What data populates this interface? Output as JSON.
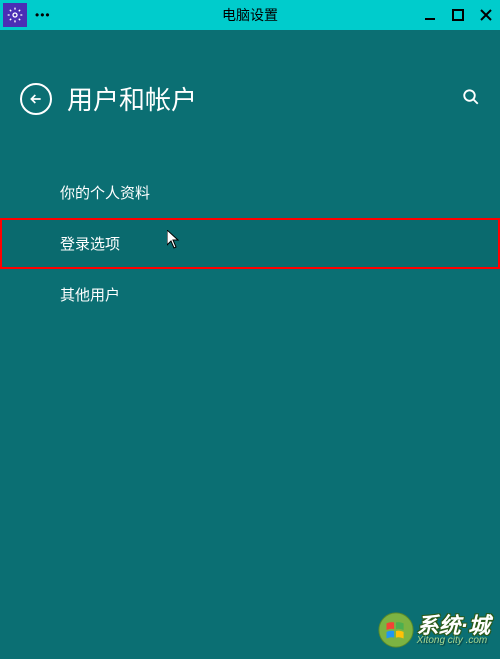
{
  "titlebar": {
    "title": "电脑设置",
    "dots": "•••"
  },
  "header": {
    "page_title": "用户和帐户"
  },
  "menu": {
    "items": [
      {
        "label": "你的个人资料"
      },
      {
        "label": "登录选项"
      },
      {
        "label": "其他用户"
      }
    ]
  },
  "watermark": {
    "main": "系统·城",
    "sub": "Xitong city .com"
  }
}
